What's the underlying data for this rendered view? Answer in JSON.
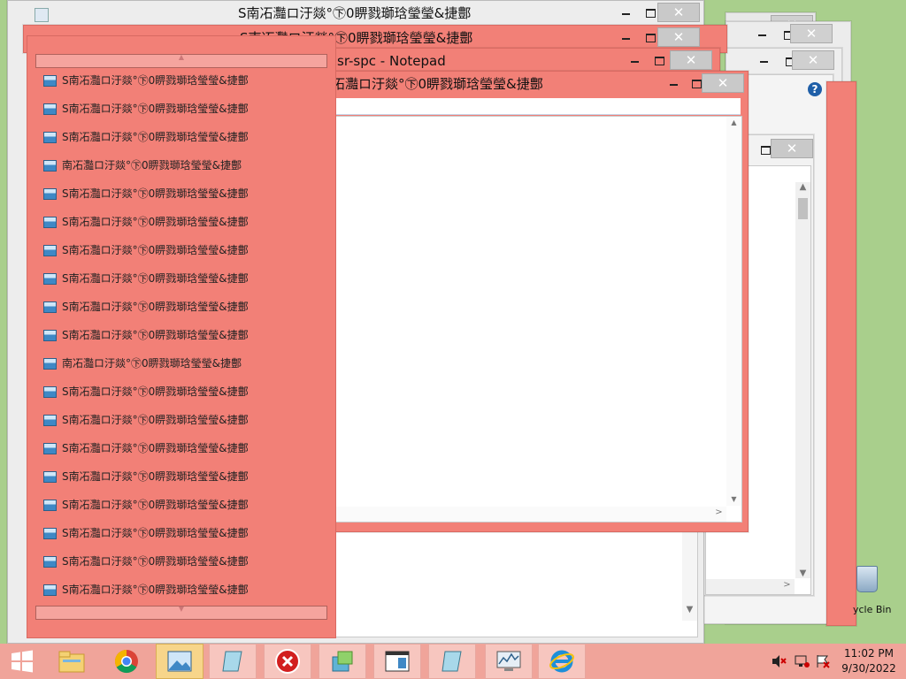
{
  "windows": {
    "top1_title": "S南㓈灩ロ汙燚°㊦0睤戮瑡琀瑩瑩&捷鄷",
    "top2_title": "S南㓈灩ロ汙燚°㊦0睤戮瑡琀瑩瑩&捷鄷",
    "notepad_title": "sr-spc - Notepad",
    "front_title": "㓈灩ロ汙燚°㊦0睤戮瑡琀瑩瑩&捷鄷"
  },
  "menu": {
    "items": [
      {
        "label": "S南㓈灩ロ汙燚°㊦0睤戮瑡琀瑩瑩&捷鄷"
      },
      {
        "label": "S南㓈灩ロ汙燚°㊦0睤戮瑡琀瑩瑩&捷鄷"
      },
      {
        "label": "S南㓈灩ロ汙燚°㊦0睤戮瑡琀瑩瑩&捷鄷"
      },
      {
        "label": "南㓈灩ロ汙燚°㊦0睤戮瑡琀瑩瑩&捷鄷"
      },
      {
        "label": "S南㓈灩ロ汙燚°㊦0睤戮瑡琀瑩瑩&捷鄷"
      },
      {
        "label": "S南㓈灩ロ汙燚°㊦0睤戮瑡琀瑩瑩&捷鄷"
      },
      {
        "label": "S南㓈灩ロ汙燚°㊦0睤戮瑡琀瑩瑩&捷鄷"
      },
      {
        "label": "S南㓈灩ロ汙燚°㊦0睤戮瑡琀瑩瑩&捷鄷"
      },
      {
        "label": "S南㓈灩ロ汙燚°㊦0睤戮瑡琀瑩瑩&捷鄷"
      },
      {
        "label": "S南㓈灩ロ汙燚°㊦0睤戮瑡琀瑩瑩&捷鄷"
      },
      {
        "label": "南㓈灩ロ汙燚°㊦0睤戮瑡琀瑩瑩&捷鄷"
      },
      {
        "label": "S南㓈灩ロ汙燚°㊦0睤戮瑡琀瑩瑩&捷鄷"
      },
      {
        "label": "S南㓈灩ロ汙燚°㊦0睤戮瑡琀瑩瑩&捷鄷"
      },
      {
        "label": "S南㓈灩ロ汙燚°㊦0睤戮瑡琀瑩瑩&捷鄷"
      },
      {
        "label": "S南㓈灩ロ汙燚°㊦0睤戮瑡琀瑩瑩&捷鄷"
      },
      {
        "label": "S南㓈灩ロ汙燚°㊦0睤戮瑡琀瑩瑩&捷鄷"
      },
      {
        "label": "S南㓈灩ロ汙燚°㊦0睤戮瑡琀瑩瑩&捷鄷"
      },
      {
        "label": "S南㓈灩ロ汙燚°㊦0睤戮瑡琀瑩瑩&捷鄷"
      },
      {
        "label": "S南㓈灩ロ汙燚°㊦0睤戮瑡琀瑩瑩&捷鄷"
      }
    ]
  },
  "desktop": {
    "recycle_bin_label": "ycle Bin"
  },
  "taskbar": {
    "time": "11:02 PM",
    "date": "9/30/2022"
  },
  "controls": {
    "close_glyph": "✕",
    "help_glyph": "?",
    "up_arrow": "▲",
    "down_arrow": "▼",
    "left_arrow": "<",
    "right_arrow": ">"
  },
  "colors": {
    "window_accent": "#f28077",
    "desktop": "#a9cf8c",
    "taskbar": "#f0a49a"
  }
}
